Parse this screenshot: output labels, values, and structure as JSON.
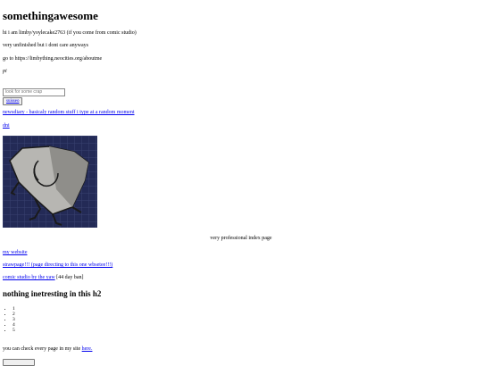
{
  "page": {
    "title": "somethingawesome",
    "intro": "hi i am limby/yoylecake2763 (if you come from comic studio)",
    "unfinished": "very unfinished but i dont care anyways",
    "goto": "go to https://limbything.neocities.org/aboutme",
    "pi": "pi"
  },
  "search": {
    "placeholder": "look for some crap",
    "button_label": "suisseo"
  },
  "links": {
    "newsdiary": "newsdiary - basicaly random stuff i type at a random moment",
    "dni": "dni",
    "my_website": "my website",
    "strawpage": "strawpage!!! (page directing to this one wbsetee!!!)",
    "comic_studio": "comic studio by the yaw",
    "comic_studio_suffix": "[44 day ban]",
    "here": "here."
  },
  "image": {
    "caption": "very professional index page",
    "colors": {
      "background": "#232a56",
      "grid": "#3a4170",
      "rock": "#b7b6b2",
      "rock_dark": "#8f8e8a",
      "outline": "#1a1a1a"
    }
  },
  "section": {
    "heading": "nothing inetresting in this h2",
    "list_items": [
      "1",
      "2",
      "3",
      "4",
      "5"
    ],
    "check_pages": "you can check every page in my site "
  }
}
